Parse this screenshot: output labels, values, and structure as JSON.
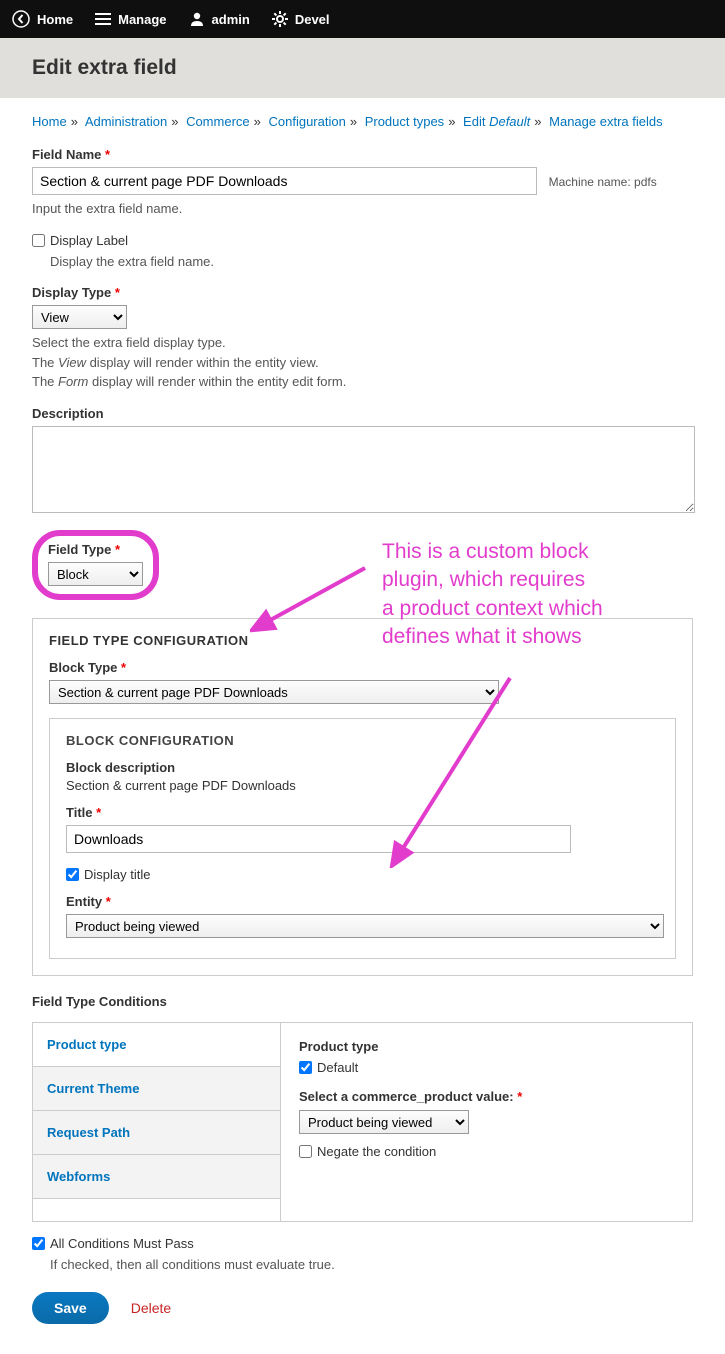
{
  "toolbar": {
    "home": "Home",
    "manage": "Manage",
    "admin": "admin",
    "devel": "Devel"
  },
  "page_title": "Edit extra field",
  "breadcrumb": {
    "items": [
      "Home",
      "Administration",
      "Commerce",
      "Configuration",
      "Product types"
    ],
    "edit_label": "Edit",
    "edit_italic": "Default",
    "last": "Manage extra fields"
  },
  "field_name": {
    "label": "Field Name",
    "value": "Section & current page PDF Downloads",
    "machine_label": "Machine name:",
    "machine_value": "pdfs",
    "help": "Input the extra field name."
  },
  "display_label": {
    "label": "Display Label",
    "help": "Display the extra field name."
  },
  "display_type": {
    "label": "Display Type",
    "value": "View",
    "help1": "Select the extra field display type.",
    "help2_pre": "The ",
    "help2_em": "View",
    "help2_post": " display will render within the entity view.",
    "help3_pre": "The ",
    "help3_em": "Form",
    "help3_post": " display will render within the entity edit form."
  },
  "description_label": "Description",
  "field_type": {
    "label": "Field Type",
    "value": "Block"
  },
  "config": {
    "title": "FIELD TYPE CONFIGURATION",
    "block_type_label": "Block Type",
    "block_type_value": "Section & current page PDF Downloads",
    "block_config_title": "BLOCK CONFIGURATION",
    "block_desc_label": "Block description",
    "block_desc_value": "Section & current page PDF Downloads",
    "title_label": "Title",
    "title_value": "Downloads",
    "display_title_label": "Display title",
    "entity_label": "Entity",
    "entity_value": "Product being viewed"
  },
  "conditions": {
    "heading": "Field Type Conditions",
    "tabs": [
      "Product type",
      "Current Theme",
      "Request Path",
      "Webforms"
    ],
    "panel_label": "Product type",
    "default_label": "Default",
    "select_label": "Select a commerce_product value:",
    "select_value": "Product being viewed",
    "negate_label": "Negate the condition"
  },
  "all_conditions": {
    "label": "All Conditions Must Pass",
    "help": "If checked, then all conditions must evaluate true."
  },
  "buttons": {
    "save": "Save",
    "delete": "Delete"
  },
  "annotation": "This is a custom block\nplugin, which requires\na product context which\ndefines what it shows"
}
